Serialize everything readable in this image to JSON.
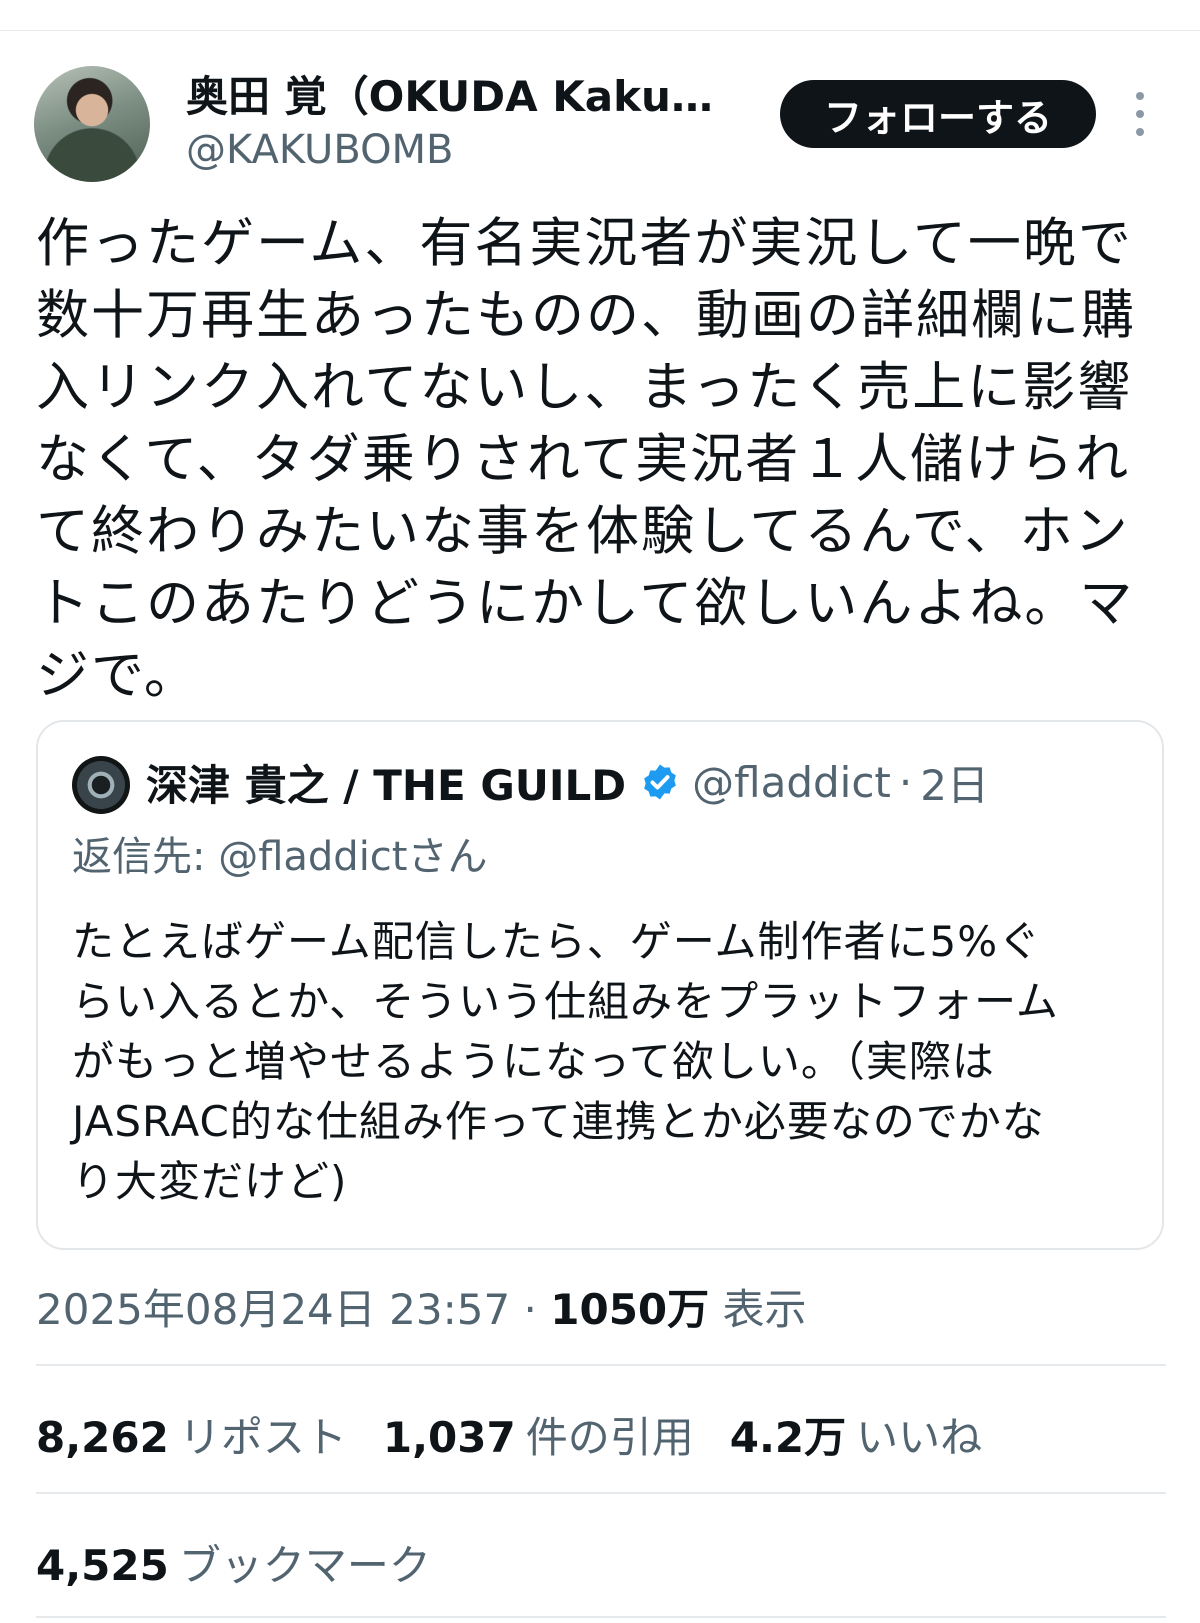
{
  "author": {
    "name": "奥田 覚（OKUDA Kaku)...",
    "handle": "@KAKUBOMB"
  },
  "follow_button_label": "フォローする",
  "tweet_text": "作ったゲーム、有名実況者が実況して一晩で\n数十万再生あったものの、動画の詳細欄に購\n入リンク入れてないし、まったく売上に影響\nなくて、タダ乗りされて実況者１人儲けられ\nて終わりみたいな事を体験してるんで、ホン\nトこのあたりどうにかして欲しいんよね。マ\nジで。",
  "quoted": {
    "name": "深津 貴之 / THE GUILD",
    "handle": "@fladdict",
    "dot": "·",
    "time": "2日",
    "reply_label": "返信先:",
    "reply_mention": "@fladdictさん",
    "text": "たとえばゲーム配信したら、ゲーム制作者に5%ぐ\nらい入るとか、そういう仕組みをプラットフォーム\nがもっと増やせるようになって欲しい。（実際は\nJASRAC的な仕組み作って連携とか必要なのでかな\nり大変だけど)"
  },
  "meta": {
    "timestamp": "2025年08月24日 23:57",
    "separator": "·",
    "views_count": "1050万",
    "views_label": "表示"
  },
  "stats": {
    "reposts_count": "8,262",
    "reposts_label": "リポスト",
    "quotes_count": "1,037",
    "quotes_label": "件の引用",
    "likes_count": "4.2万",
    "likes_label": "いいね",
    "bookmarks_count": "4,525",
    "bookmarks_label": "ブックマーク"
  },
  "colors": {
    "text_primary": "#0f1419",
    "text_secondary": "#536471",
    "verified_blue": "#1d9bf0",
    "border": "#e6e9ec"
  },
  "icons": [
    "more-icon",
    "verified-icon"
  ]
}
